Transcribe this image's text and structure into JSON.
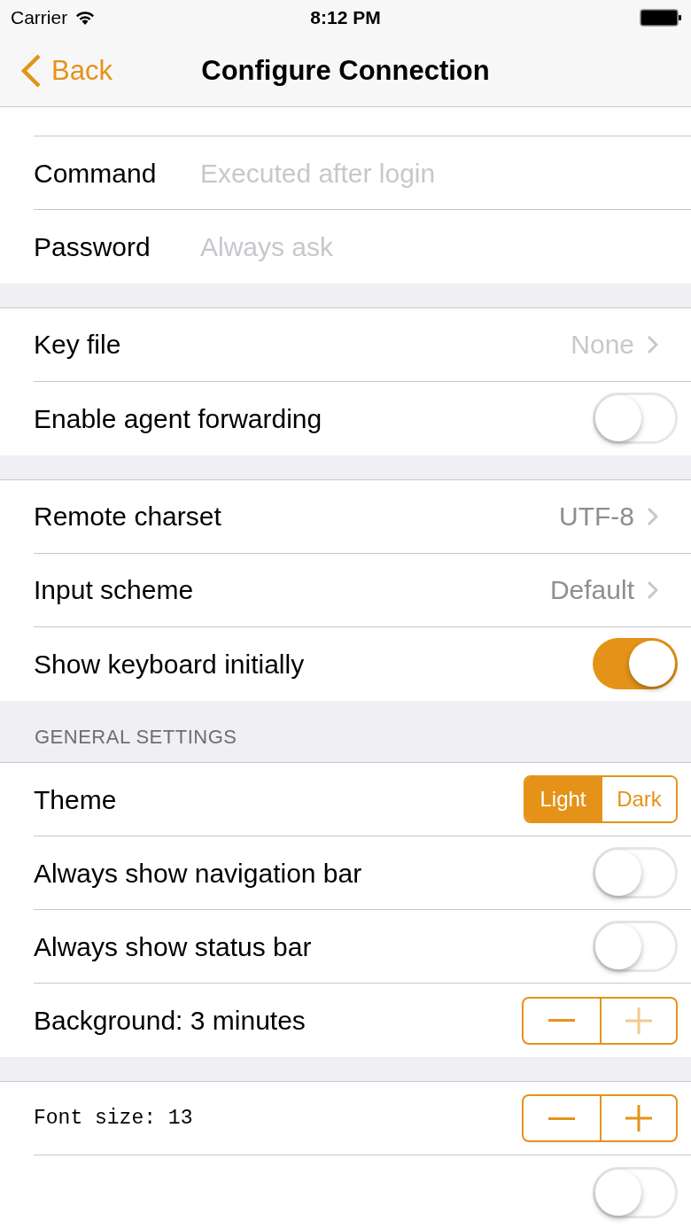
{
  "status_bar": {
    "carrier": "Carrier",
    "time": "8:12 PM"
  },
  "nav": {
    "back": "Back",
    "title": "Configure Connection"
  },
  "sections": [
    {
      "clipped_top": true,
      "rows": [
        {
          "kind": "field",
          "label": "Command",
          "placeholder": "Executed after login"
        },
        {
          "kind": "field",
          "label": "Password",
          "placeholder": "Always ask"
        }
      ]
    },
    {
      "rows": [
        {
          "kind": "disclosure",
          "label": "Key file",
          "value": "None",
          "muted": true
        },
        {
          "kind": "toggle",
          "label": "Enable agent forwarding",
          "on": false
        }
      ]
    },
    {
      "rows": [
        {
          "kind": "disclosure",
          "label": "Remote charset",
          "value": "UTF-8",
          "muted": false
        },
        {
          "kind": "disclosure",
          "label": "Input scheme",
          "value": "Default",
          "muted": false
        },
        {
          "kind": "toggle",
          "label": "Show keyboard initially",
          "on": true
        }
      ]
    },
    {
      "header": "GENERAL SETTINGS",
      "rows": [
        {
          "kind": "segmented",
          "label": "Theme",
          "segments": [
            {
              "label": "Light",
              "selected": true
            },
            {
              "label": "Dark",
              "selected": false
            }
          ]
        },
        {
          "kind": "toggle",
          "label": "Always show navigation bar",
          "on": false
        },
        {
          "kind": "toggle",
          "label": "Always show status bar",
          "on": false
        },
        {
          "kind": "stepper",
          "label": "Background: 3 minutes",
          "monospace": false,
          "minus_disabled": false,
          "plus_disabled": true
        }
      ]
    },
    {
      "rows": [
        {
          "kind": "stepper",
          "label": "Font size: 13",
          "monospace": true,
          "minus_disabled": false,
          "plus_disabled": false
        },
        {
          "kind": "toggle",
          "on": false
        }
      ]
    }
  ]
}
